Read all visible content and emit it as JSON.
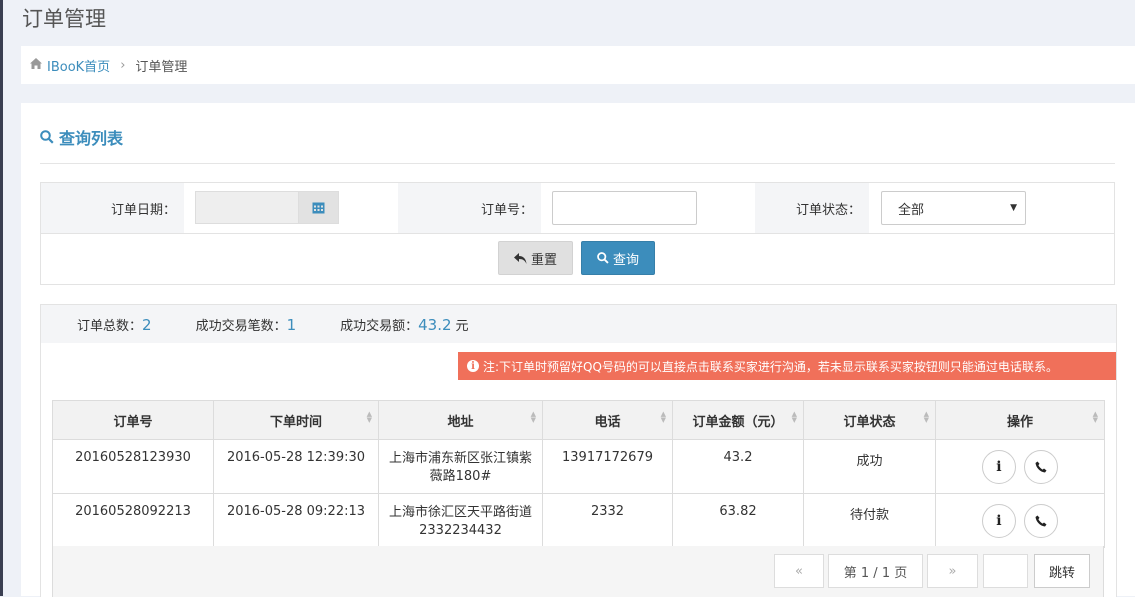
{
  "page_title": "订单管理",
  "breadcrumb": {
    "home_label": "IBooK首页",
    "current": "订单管理"
  },
  "panel": {
    "title": "查询列表"
  },
  "query": {
    "date_label": "订单日期：",
    "order_no_label": "订单号：",
    "status_label": "订单状态：",
    "status_selected": "全部",
    "reset_label": "重置",
    "query_label": "查询"
  },
  "stats": {
    "total_label": "订单总数：",
    "total_value": "2",
    "success_count_label": "成功交易笔数：",
    "success_count_value": "1",
    "success_amount_label": "成功交易额：",
    "success_amount_value": "43.2",
    "success_amount_unit": "元"
  },
  "alert": {
    "text": "注:下订单时预留好QQ号码的可以直接点击联系买家进行沟通，若未显示联系买家按钮则只能通过电话联系。"
  },
  "table": {
    "headers": [
      "订单号",
      "下单时间",
      "地址",
      "电话",
      "订单金额（元）",
      "订单状态",
      "操作"
    ],
    "rows": [
      {
        "order_no": "20160528123930",
        "time": "2016-05-28 12:39:30",
        "address": "上海市浦东新区张江镇紫薇路180#",
        "phone": "13917172679",
        "amount": "43.2",
        "status": "成功"
      },
      {
        "order_no": "20160528092213",
        "time": "2016-05-28 09:22:13",
        "address": "上海市徐汇区天平路街道2332234432",
        "phone": "2332",
        "amount": "63.82",
        "status": "待付款"
      }
    ]
  },
  "pager": {
    "prev": "«",
    "info": "第 1 / 1 页",
    "next": "»",
    "go_label": "跳转"
  },
  "colors": {
    "accent": "#3c8dbc",
    "alert": "#f0705a",
    "success": "#2e8b2e",
    "pending": "#1a1aa0"
  },
  "icons": [
    "home-icon",
    "search-icon",
    "calendar-icon",
    "undo-icon",
    "info-icon",
    "phone-icon"
  ]
}
